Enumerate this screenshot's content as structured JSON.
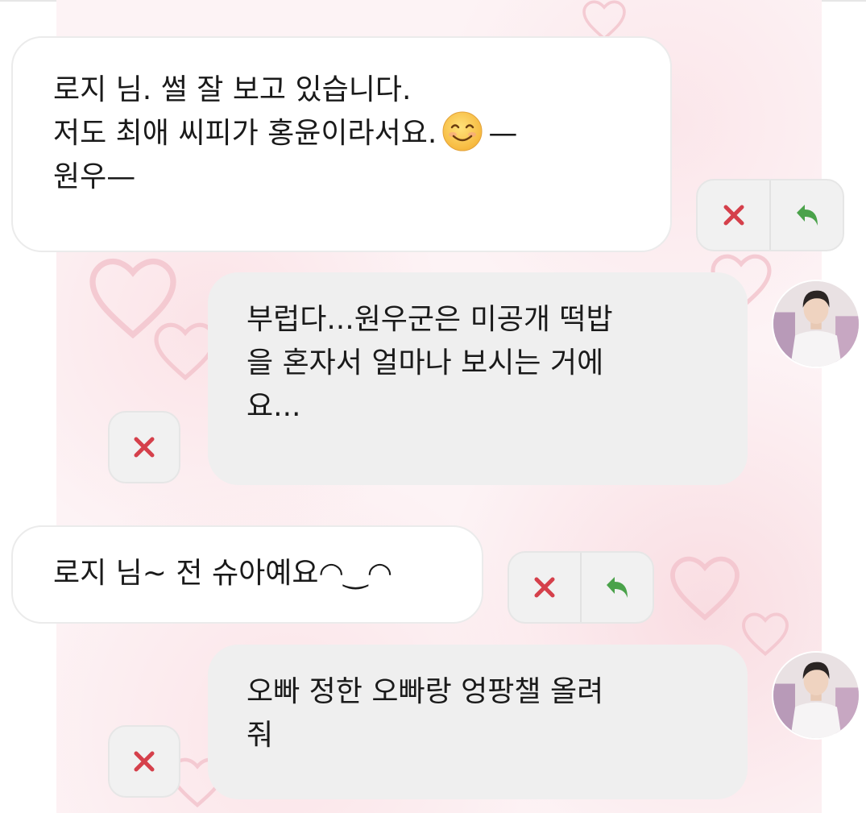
{
  "messages": [
    {
      "type": "received",
      "lines": [
        "로지 님. 썰 잘 보고 있습니다.",
        "저도 최애 씨피가 홍윤이라서요.",
        "—",
        "원우—"
      ],
      "emoji": "smiling-face-emoji"
    },
    {
      "type": "sent",
      "lines": [
        "부럽다...원우군은 미공개 떡밥",
        "을 혼자서 얼마나 보시는 거에",
        "요..."
      ]
    },
    {
      "type": "received",
      "lines": [
        "로지 님~ 전 슈아예요◠‿◠"
      ]
    },
    {
      "type": "sent",
      "lines": [
        "오빠 정한 오빠랑 엉팡챌 올려",
        "줘"
      ]
    }
  ],
  "icons": {
    "delete": "close-icon",
    "reply": "reply-icon",
    "avatar": "avatar"
  },
  "colors": {
    "delete_red": "#d5404b",
    "reply_green": "#4aa24a",
    "sent_bubble": "#efefef",
    "received_bubble": "#ffffff",
    "background_pink": "#fdf3f5"
  }
}
